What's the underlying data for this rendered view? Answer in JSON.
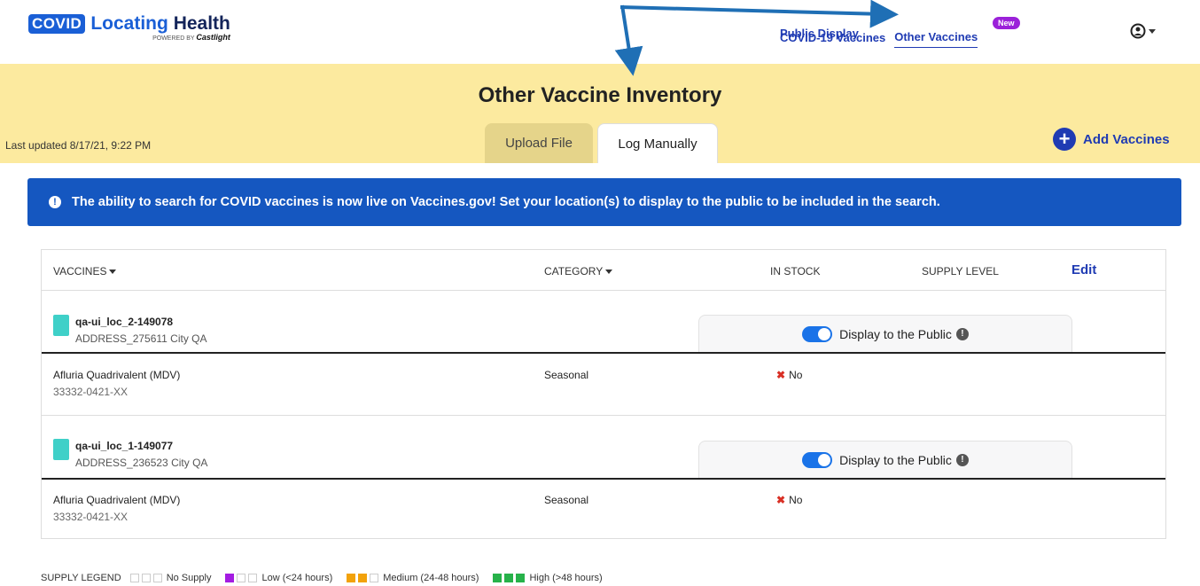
{
  "header": {
    "logo_badge": "COVID",
    "logo_main": "Locating",
    "logo_main_bold": "Health",
    "logo_powered_by": "POWERED BY",
    "logo_brand": "Castlight",
    "nav": {
      "covid_vaccines": "COVID-19 Vaccines",
      "other_vaccines": "Other Vaccines",
      "new_badge": "New",
      "public_display": "Public Display"
    },
    "account_icon": "user-circle-icon"
  },
  "page": {
    "title": "Other Vaccine Inventory",
    "last_updated": "Last updated 8/17/21, 9:22 PM",
    "tabs": [
      {
        "label": "Upload File",
        "active": false
      },
      {
        "label": "Log Manually",
        "active": true
      }
    ],
    "add_vaccines": "Add Vaccines"
  },
  "banner": {
    "text": "The ability to search for COVID vaccines is now live on Vaccines.gov! Set your location(s) to display to the public to be included in the search.",
    "color": "#1557c0"
  },
  "table": {
    "columns": {
      "vaccines": "VACCINES",
      "category": "CATEGORY",
      "in_stock": "IN STOCK",
      "supply_level": "SUPPLY LEVEL",
      "edit": "Edit"
    },
    "locations": [
      {
        "name": "qa-ui_loc_2-149078",
        "address": "ADDRESS_275611 City QA",
        "display_label": "Display to the Public",
        "display_on": true,
        "vaccines": [
          {
            "name": "Afluria Quadrivalent (MDV)",
            "code": "33332-0421-XX",
            "category": "Seasonal",
            "in_stock": "No"
          }
        ]
      },
      {
        "name": "qa-ui_loc_1-149077",
        "address": "ADDRESS_236523 City QA",
        "display_label": "Display to the Public",
        "display_on": true,
        "vaccines": [
          {
            "name": "Afluria Quadrivalent (MDV)",
            "code": "33332-0421-XX",
            "category": "Seasonal",
            "in_stock": "No"
          }
        ]
      }
    ]
  },
  "legend": {
    "title": "SUPPLY LEGEND",
    "items": [
      {
        "label": "No Supply",
        "filled": 0,
        "color": "#cccccc"
      },
      {
        "label": "Low (<24 hours)",
        "filled": 1,
        "color": "#a41ce2"
      },
      {
        "label": "Medium (24-48 hours)",
        "filled": 2,
        "color": "#f2a20b"
      },
      {
        "label": "High (>48 hours)",
        "filled": 3,
        "color": "#27b24a"
      }
    ]
  }
}
